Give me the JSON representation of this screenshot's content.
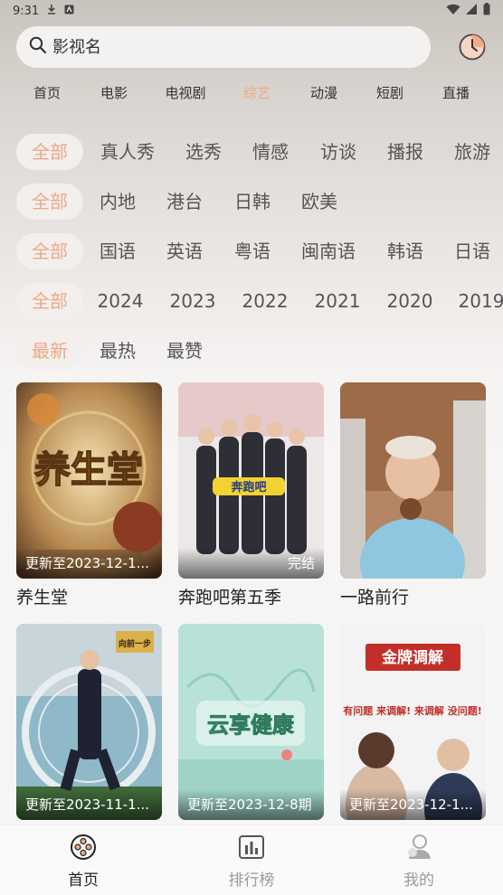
{
  "status_bar": {
    "time": "9:31"
  },
  "search": {
    "placeholder": "影视名"
  },
  "nav_tabs": [
    {
      "label": "首页",
      "active": false
    },
    {
      "label": "电影",
      "active": false
    },
    {
      "label": "电视剧",
      "active": false
    },
    {
      "label": "综艺",
      "active": true
    },
    {
      "label": "动漫",
      "active": false
    },
    {
      "label": "短剧",
      "active": false
    },
    {
      "label": "直播",
      "active": false
    }
  ],
  "filters": {
    "genre": [
      "全部",
      "真人秀",
      "选秀",
      "情感",
      "访谈",
      "播报",
      "旅游"
    ],
    "region": [
      "全部",
      "内地",
      "港台",
      "日韩",
      "欧美"
    ],
    "language": [
      "全部",
      "国语",
      "英语",
      "粤语",
      "闽南语",
      "韩语",
      "日语"
    ],
    "year": [
      "全部",
      "2024",
      "2023",
      "2022",
      "2021",
      "2020",
      "2019"
    ],
    "sort": [
      "最新",
      "最热",
      "最赞"
    ]
  },
  "cards": [
    {
      "title": "养生堂",
      "badge": "更新至2023-12-1...",
      "poster_text": "养生堂"
    },
    {
      "title": "奔跑吧第五季",
      "badge": "完结",
      "poster_text": "奔跑吧"
    },
    {
      "title": "一路前行",
      "badge": "",
      "poster_text": ""
    },
    {
      "title": "",
      "badge": "更新至2023-11-1...",
      "poster_text": "向前一步"
    },
    {
      "title": "",
      "badge": "更新至2023-12-8期",
      "poster_text": "云享健康"
    },
    {
      "title": "",
      "badge": "更新至2023-12-1...",
      "poster_text": "金牌调解",
      "poster_subtext": "有问题 来调解! 来调解 没问题!"
    }
  ],
  "bottom_nav": [
    {
      "label": "首页",
      "icon": "film-reel-icon",
      "active": true
    },
    {
      "label": "排行榜",
      "icon": "chart-icon",
      "active": false
    },
    {
      "label": "我的",
      "icon": "person-icon",
      "active": false
    }
  ],
  "colors": {
    "accent": "#f0a884",
    "chip_bg": "#f2efed"
  }
}
